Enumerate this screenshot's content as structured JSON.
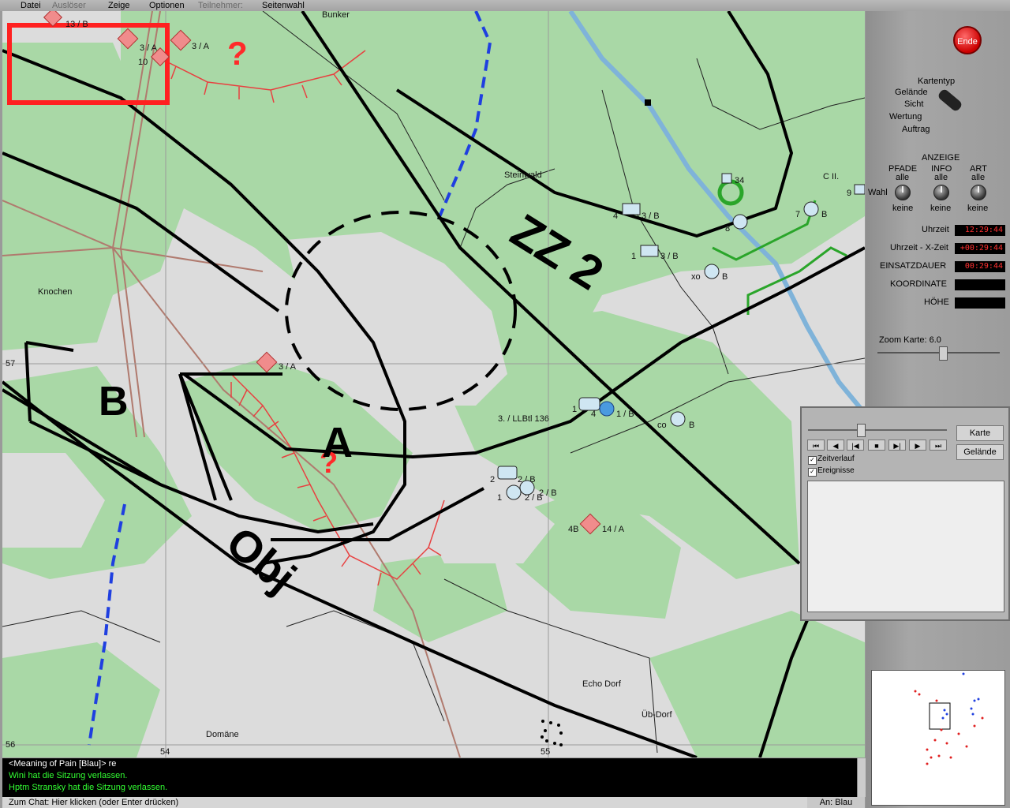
{
  "menu": {
    "items": [
      "Datei",
      "Auslöser",
      "Zeige",
      "Optionen",
      "Teilnehmer:",
      "Seitenwahl"
    ]
  },
  "map": {
    "places": [
      "Knochen",
      "Steinwald",
      "Echo Dorf",
      "Üb-Dorf",
      "Domäne",
      "Bunker"
    ],
    "grid_labels": [
      "57",
      "56",
      "54",
      "55"
    ],
    "overlay_labels": [
      "ZZ 2",
      "Obj",
      "A",
      "B"
    ],
    "unit_labels": [
      "3 / A",
      "13 / B",
      "3 / A",
      "3 / A",
      "3 / B",
      "3 / B",
      "B",
      "B",
      "B",
      "B",
      "14 / A",
      "2 / B",
      "2 / B",
      "1 / B",
      "C II.",
      "3. / LLBtl 136",
      "34",
      "xo",
      "co",
      "4B",
      "1",
      "4",
      "1",
      "4",
      "10",
      "8",
      "7",
      "9",
      "2",
      "1"
    ],
    "colors": {
      "forest": "#a9d8a6",
      "open": "#dcdcdc",
      "friendly": "#cfe6f2",
      "enemy": "#f08c8c",
      "overlay": "#000000"
    }
  },
  "right_panel": {
    "end_button": "Ende",
    "map_type_options": [
      "Kartentyp",
      "Gelände",
      "Sicht",
      "Wertung",
      "Auftrag"
    ],
    "anzeige_title": "ANZEIGE",
    "columns": [
      {
        "title": "PFADE",
        "top": "alle",
        "bottom": "keine"
      },
      {
        "title": "INFO",
        "top": "alle",
        "bottom": "keine"
      },
      {
        "title": "ART",
        "top": "alle",
        "bottom": "keine"
      }
    ],
    "wahl_label": "Wahl",
    "time_rows": [
      {
        "label": "Uhrzeit",
        "value": "12:29:44"
      },
      {
        "label": "Uhrzeit - X-Zeit",
        "value": "+00:29:44"
      },
      {
        "label": "EINSATZDAUER",
        "value": "00:29:44"
      },
      {
        "label": "KOORDINATE",
        "value": ""
      },
      {
        "label": "HÖHE",
        "value": ""
      }
    ],
    "zoom_label": "Zoom Karte:",
    "zoom_value": "6.0"
  },
  "replay": {
    "buttons": [
      "⏮",
      "◀",
      "|◀",
      "■",
      "▶|",
      "▶",
      "⏭"
    ],
    "karte_button": "Karte",
    "gelaende_button": "Gelände",
    "checkboxes": [
      {
        "label": "Zeitverlauf",
        "checked": "✓"
      },
      {
        "label": "Ereignisse",
        "checked": "✓"
      }
    ]
  },
  "chat": {
    "lines": [
      {
        "text": "<Meaning of Pain [Blau]>  re",
        "color": "#ffffff"
      },
      {
        "text": "Wini hat die Sitzung verlassen.",
        "color": "#33ff33"
      },
      {
        "text": "Hptm Stransky hat die Sitzung verlassen.",
        "color": "#33ff33"
      }
    ],
    "input_text": "Zum Chat: Hier klicken (oder Enter drücken)",
    "recipient": "An: Blau"
  }
}
